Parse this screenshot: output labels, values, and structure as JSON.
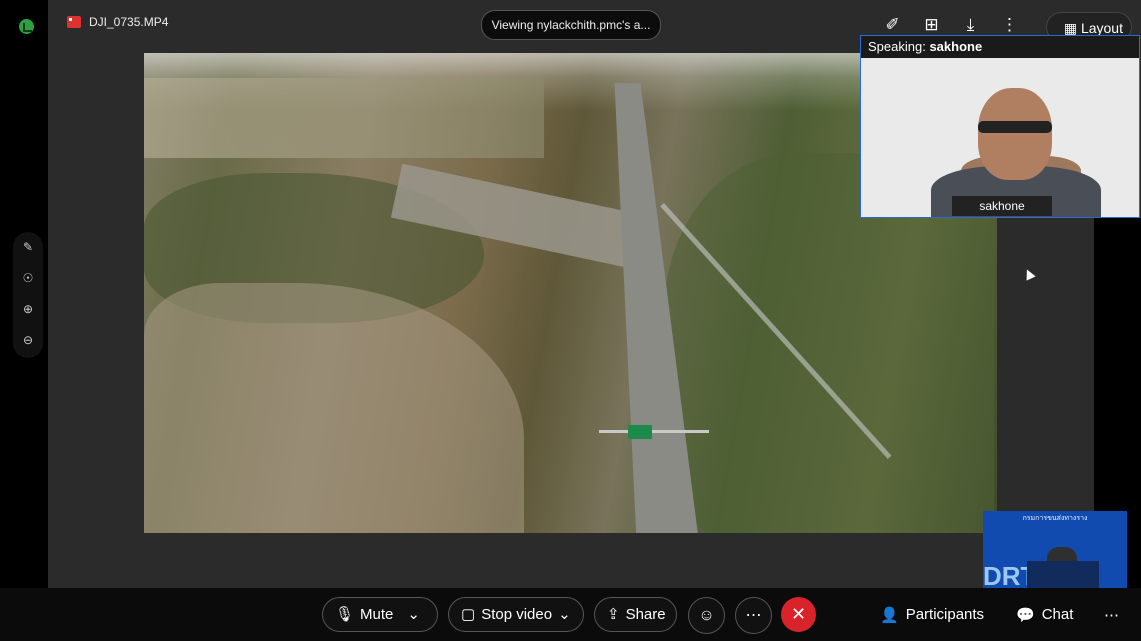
{
  "file_tag": {
    "name": "DJI_0735.MP4"
  },
  "viewing": {
    "text": "Viewing nylackchith.pmc's a..."
  },
  "layout": {
    "label": "Layout"
  },
  "camera": {
    "speaking_label": "Speaking:",
    "speaker": "sakhone",
    "name_badge": "sakhone"
  },
  "pip": {
    "title": "กรมการขนส่งทางราง",
    "letters": "DRT"
  },
  "toolbar": {
    "mute_label": "Mute",
    "stop_video_label": "Stop video",
    "share_label": "Share",
    "participants_label": "Participants",
    "chat_label": "Chat"
  },
  "colors": {
    "leave_button": "#d9232b",
    "active_border": "#2a6bd1",
    "signal": "#2ea043"
  }
}
